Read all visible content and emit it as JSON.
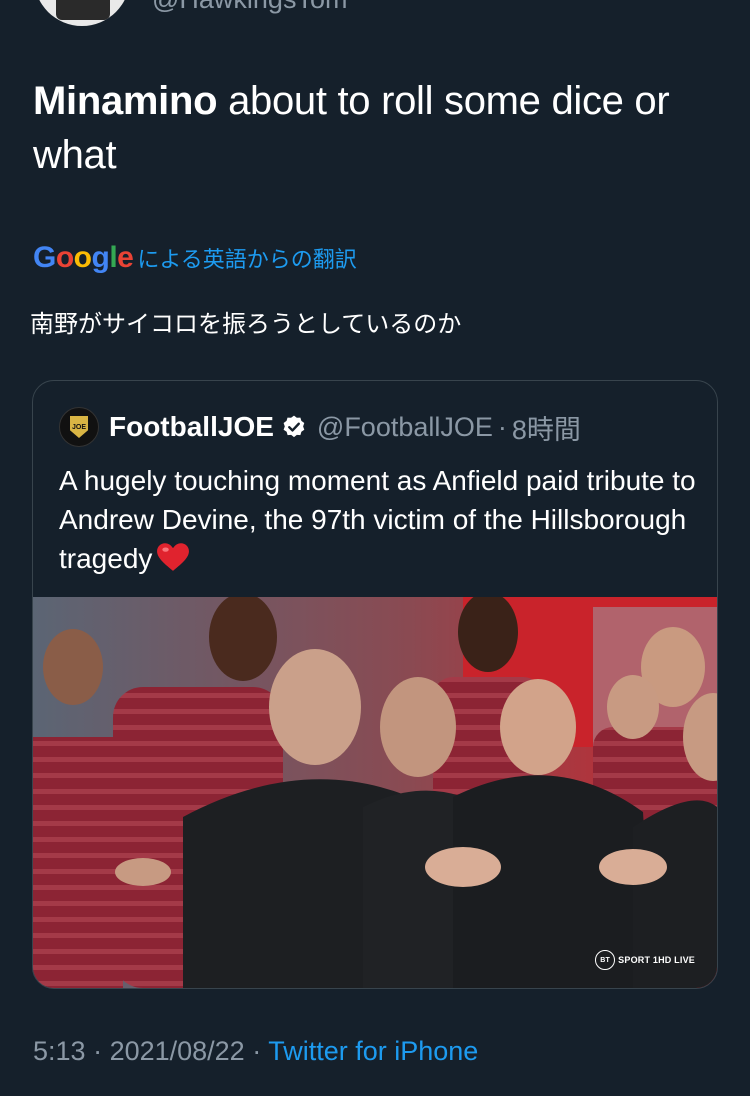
{
  "author": {
    "handle": "@HawkingsTom"
  },
  "tweet": {
    "bold": "Minamino",
    "rest": " about to roll some dice or what"
  },
  "translation": {
    "logo_letters": [
      "G",
      "o",
      "o",
      "g",
      "l",
      "e"
    ],
    "label": "による英語からの翻訳",
    "text": "南野がサイコロを振ろうとしているのか"
  },
  "quote": {
    "name": "FootballJOE",
    "handle": "@FootballJOE",
    "separator": "·",
    "time": "8時間",
    "avatar_text": "JOE",
    "text": "A hugely touching moment as Anfield paid tribute to Andrew Devine, the 97th victim of the Hillsborough tragedy",
    "emoji": "red-heart",
    "image": {
      "badge_brand": "BT",
      "badge_text": "SPORT 1HD LIVE"
    }
  },
  "meta": {
    "time": "5:13",
    "dot1": " · ",
    "date": "2021/08/22",
    "dot2": " · ",
    "source": "Twitter for iPhone"
  },
  "colors": {
    "background": "#15202b",
    "muted": "#8b98a5",
    "link": "#1d9bf0",
    "border": "#38444d"
  }
}
